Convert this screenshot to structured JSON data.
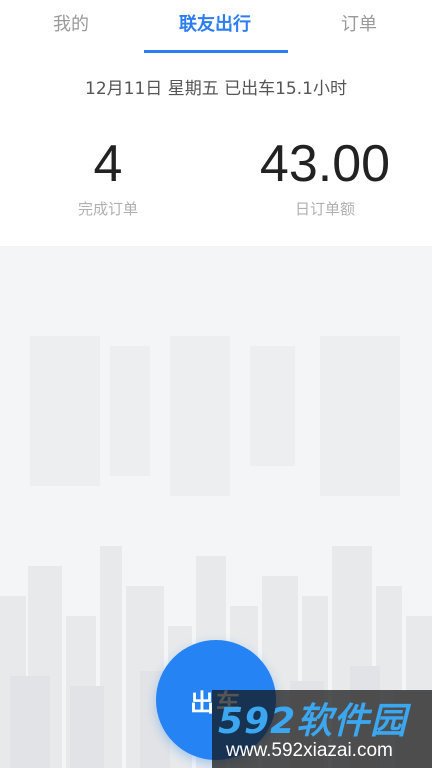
{
  "tabs": {
    "mine": "我的",
    "active": "联友出行",
    "orders": "订单"
  },
  "stats": {
    "date_line": "12月11日 星期五 已出车15.1小时",
    "completed_count": "4",
    "completed_label": "完成订单",
    "daily_amount": "43.00",
    "daily_amount_label": "日订单额"
  },
  "go_button": {
    "label": "出车"
  },
  "watermark": {
    "logo_text": "592软件园",
    "url": "www.592xiazai.com"
  },
  "colors": {
    "accent": "#2d7df2",
    "button": "#2683f3",
    "muted_text": "#b0b0b0"
  }
}
